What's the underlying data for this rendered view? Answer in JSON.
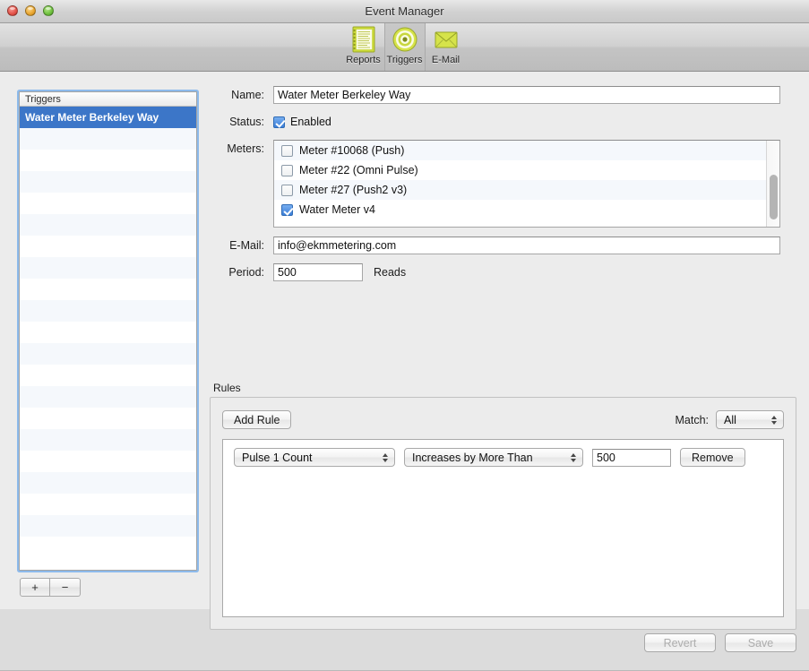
{
  "window": {
    "title": "Event Manager",
    "traffic_lights": [
      "close-button",
      "minimize-button",
      "zoom-button"
    ]
  },
  "toolbar": {
    "items": [
      {
        "label": "Reports",
        "icon": "reports-icon",
        "selected": false
      },
      {
        "label": "Triggers",
        "icon": "triggers-icon",
        "selected": true
      },
      {
        "label": "E-Mail",
        "icon": "email-icon",
        "selected": false
      }
    ]
  },
  "sidebar": {
    "column_header": "Triggers",
    "items": [
      {
        "label": "Water Meter Berkeley Way",
        "selected": true
      }
    ],
    "add_button": "+",
    "remove_button": "−"
  },
  "form": {
    "name": {
      "label": "Name:",
      "value": "Water Meter Berkeley Way"
    },
    "status": {
      "label": "Status:",
      "checkbox_label": "Enabled",
      "checked": true
    },
    "meters": {
      "label": "Meters:",
      "rows": [
        {
          "label": "Meter #10068 (Push)",
          "checked": false
        },
        {
          "label": "Meter #22 (Omni Pulse)",
          "checked": false
        },
        {
          "label": "Meter #27 (Push2 v3)",
          "checked": false
        },
        {
          "label": "Water Meter v4",
          "checked": true
        }
      ]
    },
    "email": {
      "label": "E-Mail:",
      "value": "info@ekmmetering.com"
    },
    "period": {
      "label": "Period:",
      "value": "500",
      "unit": "Reads"
    }
  },
  "rules": {
    "group_label": "Rules",
    "add_rule_button": "Add Rule",
    "match_label": "Match:",
    "match_value": "All",
    "rows": [
      {
        "field": "Pulse 1 Count",
        "operator": "Increases by More Than",
        "value": "500",
        "remove_button": "Remove"
      }
    ]
  },
  "footer": {
    "revert_button": "Revert",
    "save_button": "Save"
  },
  "colors": {
    "selection_blue": "#3c76c8",
    "toolbar_icon_green": "#cddc39",
    "focus_ring": "#6eaaeb"
  }
}
